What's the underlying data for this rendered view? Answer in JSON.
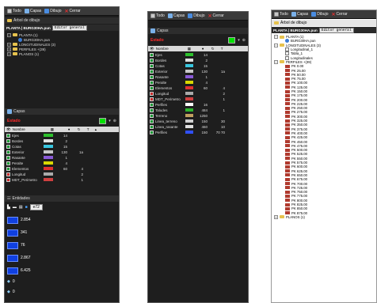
{
  "tabs": {
    "todo": "Todo",
    "capas": "Capas",
    "dibujo": "Dibujo",
    "cerrar": "Cerrar"
  },
  "arbol": {
    "title": "Árbol de dibujo",
    "planta_label": "PLANTA | BURG30HA.pun",
    "editor_label": "Editor general",
    "nodes": [
      "PLANTA (1)",
      "BURG30HA.pun",
      "LONGITUDINALES (3)",
      "PERFILES +(39)",
      "PLANOS (1)"
    ]
  },
  "capas": {
    "title": "Capas",
    "current_label": "Estado",
    "header": {
      "nombre": "Nombre",
      "t": "T"
    },
    "layers": [
      {
        "name": "Ejes",
        "color": "#2dc12d",
        "count": "14",
        "extra": ""
      },
      {
        "name": "Bordes",
        "color": "#e2e2e2",
        "count": "2",
        "extra": ""
      },
      {
        "name": "Cotas",
        "color": "#39c7e0",
        "count": "15",
        "extra": ""
      },
      {
        "name": "Exterior",
        "color": "#c8c8c8",
        "count": "130",
        "extra": "1a"
      },
      {
        "name": "Rasante",
        "color": "#8a5ad8",
        "count": "1",
        "extra": ""
      },
      {
        "name": "Peralte",
        "color": "#d8d800",
        "count": "4",
        "extra": ""
      },
      {
        "name": "Elementos",
        "color": "#e03030",
        "count": "60",
        "extra": "4"
      },
      {
        "name": "Longitud",
        "color": "#aaaaaa",
        "count": "",
        "extra": "2"
      },
      {
        "name": "MDT_Perimetro",
        "color": "#d04040",
        "count": "",
        "extra": "1"
      }
    ],
    "layers_mid_extra": [
      {
        "name": "Perfiles",
        "color": "#ffffff",
        "count": "16",
        "extra": ""
      },
      {
        "name": "Taludes",
        "color": "#2db52d",
        "count": "484",
        "extra": "1"
      },
      {
        "name": "Terreno",
        "color": "#c0a060",
        "count": "1250",
        "extra": ""
      },
      {
        "name": "Linea_terreno",
        "color": "#d0d0d0",
        "count": "150",
        "extra": "30"
      },
      {
        "name": "Linea_rasante",
        "color": "#e0e0e0",
        "count": "460",
        "extra": "10"
      },
      {
        "name": "Perfiles",
        "color": "#3050ff",
        "count": "150",
        "extra": "70 70"
      }
    ]
  },
  "entidades": {
    "title": "Entidades",
    "select_label": "e72",
    "rows": [
      {
        "value": "2.854"
      },
      {
        "value": "341"
      },
      {
        "value": "76"
      },
      {
        "value": "2.867"
      },
      {
        "value": "6.425"
      },
      {
        "value": "0"
      },
      {
        "value": "0"
      }
    ]
  },
  "perfiles": {
    "tabla": "Tabla_1",
    "longitudinales": [
      "Longitudinal_1",
      "Tabla_1",
      "Longitudinales"
    ],
    "pks": [
      "PK 0.00",
      "PK 25.00",
      "PK 50.00",
      "PK 75.00",
      "PK 100.00",
      "PK 125.00",
      "PK 150.00",
      "PK 175.00",
      "PK 200.00",
      "PK 225.00",
      "PK 250.00",
      "PK 275.00",
      "PK 300.00",
      "PK 325.00",
      "PK 350.00",
      "PK 375.00",
      "PK 400.00",
      "PK 425.00",
      "PK 450.00",
      "PK 475.00",
      "PK 500.00",
      "PK 525.00",
      "PK 550.00",
      "PK 575.00",
      "PK 600.00",
      "PK 625.00",
      "PK 650.00",
      "PK 675.00",
      "PK 700.00",
      "PK 725.00",
      "PK 750.00",
      "PK 775.00",
      "PK 800.00",
      "PK 825.00",
      "PK 850.00",
      "PK 875.00"
    ],
    "planos": "PLANOS (1)"
  }
}
